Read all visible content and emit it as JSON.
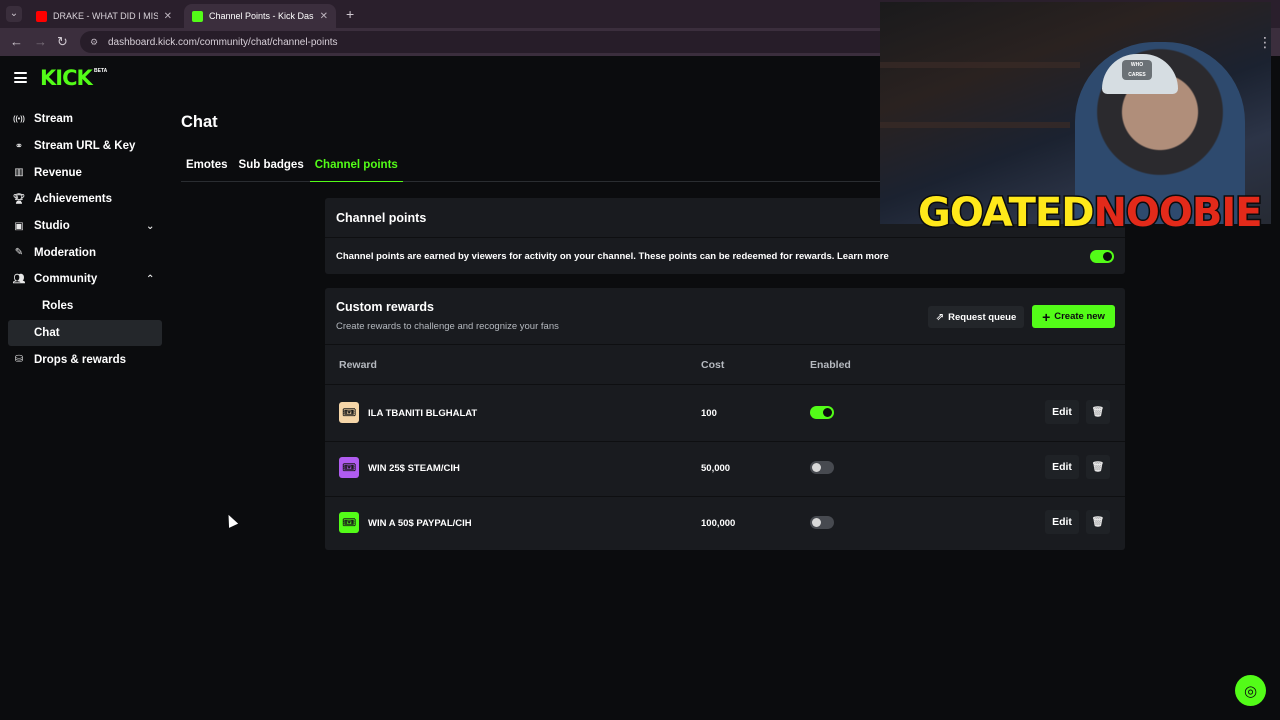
{
  "browser": {
    "tabs": [
      {
        "title": "DRAKE - WHAT DID I MISS - YouTube",
        "favicon_color": "#ff0000"
      },
      {
        "title": "Channel Points - Kick Dashboard",
        "favicon_color": "#53fc18"
      }
    ],
    "new_tab_symbol": "+",
    "url": "dashboard.kick.com/community/chat/channel-points"
  },
  "header": {
    "logo": "KICK",
    "beta": "BETA"
  },
  "sidebar": {
    "items": [
      {
        "label": "Stream",
        "icon": "broadcast-icon",
        "glyph": "((•))"
      },
      {
        "label": "Stream URL & Key",
        "icon": "link-icon",
        "glyph": "⚭"
      },
      {
        "label": "Revenue",
        "icon": "chart-icon",
        "glyph": "▥"
      },
      {
        "label": "Achievements",
        "icon": "trophy-icon",
        "glyph": "🏆︎"
      },
      {
        "label": "Studio",
        "icon": "studio-icon",
        "glyph": "▣"
      },
      {
        "label": "Moderation",
        "icon": "wrench-icon",
        "glyph": "✎"
      },
      {
        "label": "Community",
        "icon": "users-icon",
        "glyph": "👥︎"
      }
    ],
    "sub_items": [
      "Roles",
      "Chat"
    ],
    "last_item": {
      "label": "Drops & rewards",
      "icon": "drops-icon",
      "glyph": "⛁"
    }
  },
  "main": {
    "title": "Chat",
    "tabs": [
      "Emotes",
      "Sub badges",
      "Channel points"
    ],
    "active_tab": "Channel points"
  },
  "channel_points": {
    "title": "Channel points",
    "description": "Channel points are earned by viewers for activity on your channel. These points can be redeemed for rewards. Learn more",
    "enabled": true
  },
  "custom_rewards": {
    "title": "Custom rewards",
    "subtitle": "Create rewards to challenge and recognize your fans",
    "request_queue_label": "Request queue",
    "create_new_label": "Create new",
    "columns": [
      "Reward",
      "Cost",
      "Enabled"
    ],
    "rows": [
      {
        "name": "ILA TBANITI BLGHALAT",
        "cost": "100",
        "enabled": true,
        "icon_color": "#f5d6a8",
        "edit": "Edit"
      },
      {
        "name": "WIN 25$ STEAM/CIH",
        "cost": "50,000",
        "enabled": false,
        "icon_color": "#b05cf0",
        "edit": "Edit"
      },
      {
        "name": "WIN A 50$ PAYPAL/CIH",
        "cost": "100,000",
        "enabled": false,
        "icon_color": "#53fc18",
        "edit": "Edit"
      }
    ]
  },
  "webcam_overlay": {
    "name_part1": "GOATED",
    "name_part2": "NOOBIE",
    "cap_text": "WHO CARES"
  },
  "colors": {
    "accent": "#53fc18",
    "background": "#0b0c0e",
    "panel": "#191b1f"
  }
}
